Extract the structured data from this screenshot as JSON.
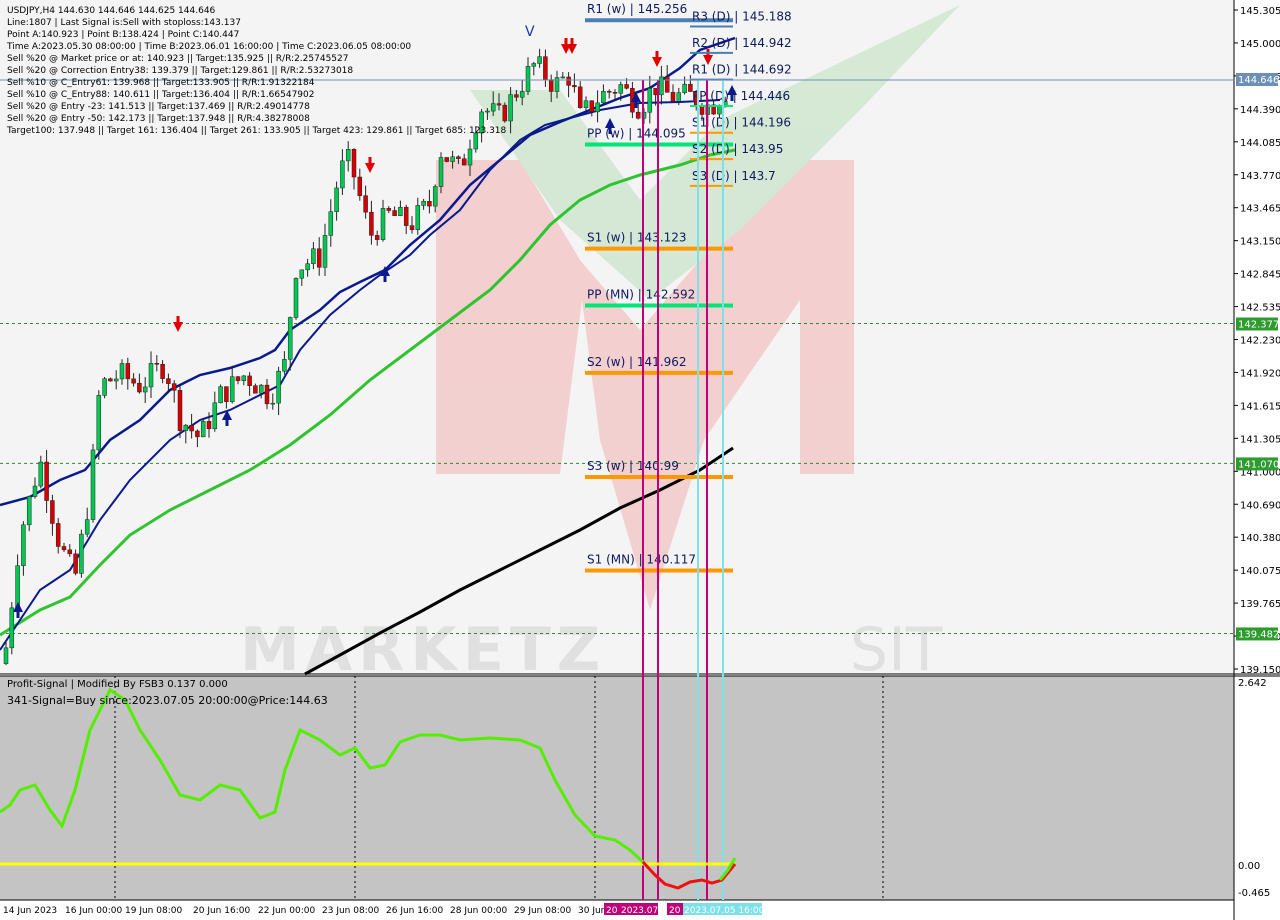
{
  "info_lines": [
    "USDJPY,H4   144.630 144.646 144.625 144.646",
    "Line:1807  |  Last Signal is:Sell with stoploss:143.137",
    "Point A:140.923  |  Point B:138.424  |  Point C:140.447",
    "Time A:2023.05.30 08:00:00  |  Time B:2023.06.01 16:00:00  |  Time C:2023.06.05 08:00:00",
    "Sell %20 @ Market price or at: 140.923  ||  Target:135.925  ||  R/R:2.25745527",
    "Sell %20 @ Correction Entry38: 139.379  ||  Target:129.861  ||  R/R:2.53273018",
    "Sell %10 @ C_Entry61: 139.968  ||  Target:133.905  ||  R/R:1.91322184",
    "Sell %10 @ C_Entry88: 140.611  ||  Target:136.404  ||  R/R:1.66547902",
    "Sell %20 @ Entry -23: 141.513  ||  Target:137.469  ||  R/R:2.49014778",
    "Sell %20 @ Entry -50: 142.173  ||  Target:137.948  ||  R/R:4.38278008",
    "Target100: 137.948  ||  Target 161: 136.404  ||  Target 261: 133.905  ||  Target 423: 129.861  ||  Target 685: 123.318"
  ],
  "price_axis": {
    "ticks": [
      "145.305",
      "145.000",
      "144.696",
      "144.390",
      "144.085",
      "143.770",
      "143.465",
      "143.150",
      "142.845",
      "142.535",
      "142.230",
      "141.920",
      "141.615",
      "141.305",
      "141.000",
      "140.690",
      "140.380",
      "140.075",
      "139.765",
      "139.460",
      "139.150"
    ],
    "current_price": "144.646",
    "hlines": [
      {
        "label": "142.377",
        "value": 142.377
      },
      {
        "label": "141.070",
        "value": 141.07
      },
      {
        "label": "139.482",
        "value": 139.482
      }
    ]
  },
  "pivots": [
    {
      "label": "R1 (w) | 145.256",
      "value": 145.256,
      "color": "#4a7fb5"
    },
    {
      "label": "R3 (D) | 145.188",
      "value": 145.188,
      "color": "#4a7fb5"
    },
    {
      "label": "R2 (D) | 144.942",
      "value": 144.942,
      "color": "#4a7fb5"
    },
    {
      "label": "R1 (D) | 144.692",
      "value": 144.692,
      "color": "#4a7fb5"
    },
    {
      "label": "PP (D) | 144.446",
      "value": 144.446,
      "color": "#00e676"
    },
    {
      "label": "S1 (D) | 144.196",
      "value": 144.196,
      "color": "#ff9800"
    },
    {
      "label": "PP (w) | 144.095",
      "value": 144.095,
      "color": "#00e676"
    },
    {
      "label": "S2 (D) | 143.95",
      "value": 143.95,
      "color": "#ff9800"
    },
    {
      "label": "S3 (D) | 143.7",
      "value": 143.7,
      "color": "#ff9800"
    },
    {
      "label": "S1 (w) | 143.123",
      "value": 143.123,
      "color": "#ff9800"
    },
    {
      "label": "PP (MN) | 142.592",
      "value": 142.592,
      "color": "#00e676"
    },
    {
      "label": "S2 (w) | 141.962",
      "value": 141.962,
      "color": "#ff9800"
    },
    {
      "label": "S3 (w) | 140.99",
      "value": 140.99,
      "color": "#ff9800"
    },
    {
      "label": "S1 (MN) | 140.117",
      "value": 140.117,
      "color": "#ff9800"
    }
  ],
  "time_axis": [
    "14 Jun 2023",
    "16 Jun 00:00",
    "19 Jun 08:00",
    "20 Jun 16:00",
    "22 Jun 00:00",
    "23 Jun 08:00",
    "26 Jun 16:00",
    "28 Jun 00:00",
    "29 Jun 08:00",
    "30 Jun",
    "2023.07.",
    "2023.07.05 16:00"
  ],
  "time_axis_prefix": [
    "20",
    "20"
  ],
  "indicator": {
    "title": "Profit-Signal | Modified By FSB3 0.137 0.000",
    "signal": "341-Signal=Buy since:2023.07.05 20:00:00@Price:144.63",
    "ticks": [
      "2.642",
      "0.00",
      "-0.465"
    ]
  },
  "colors": {
    "ma_fast": "#0a1a8c",
    "ma_mid": "#2fc42f",
    "ma_slow": "#000000",
    "bull": "#00c853",
    "bear": "#d50000",
    "signal_green": "#55ee00",
    "signal_red": "#ee1111",
    "zero_line": "#ffff00",
    "magenta": "#c0007a",
    "cyan": "#7ee0e8"
  },
  "chart_data": {
    "type": "line",
    "title": "USDJPY,H4",
    "ylim": [
      139.15,
      145.305
    ],
    "x": [
      "14 Jun 2023",
      "16 Jun 00:00",
      "19 Jun 08:00",
      "20 Jun 16:00",
      "22 Jun 00:00",
      "23 Jun 08:00",
      "26 Jun 16:00",
      "28 Jun 00:00",
      "29 Jun 08:00",
      "30 Jun",
      "2023.07.05 16:00"
    ],
    "series": [
      {
        "values": [
          140.95,
          141.25,
          141.85,
          141.65,
          141.75,
          143.8,
          143.45,
          144.3,
          144.85,
          144.7,
          144.65
        ]
      }
    ]
  }
}
